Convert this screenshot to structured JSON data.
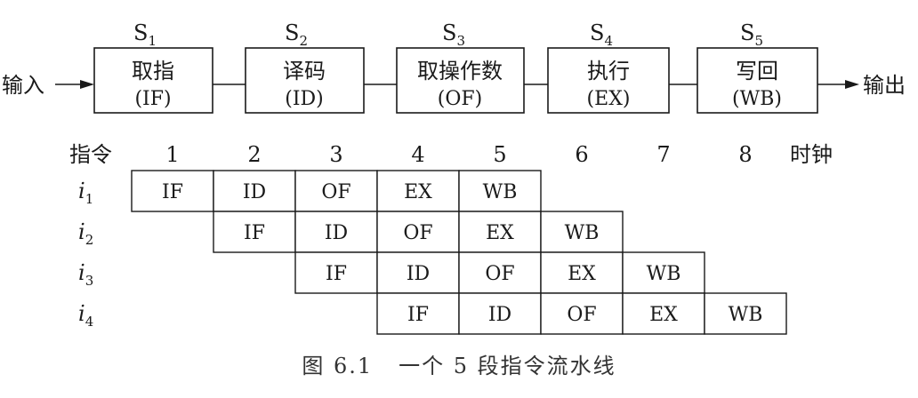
{
  "input_label": "输入",
  "output_label": "输出",
  "stages": [
    {
      "sub_prefix": "S",
      "sub_index": "1",
      "name": "取指",
      "abbr": "(IF)"
    },
    {
      "sub_prefix": "S",
      "sub_index": "2",
      "name": "译码",
      "abbr": "(ID)"
    },
    {
      "sub_prefix": "S",
      "sub_index": "3",
      "name": "取操作数",
      "abbr": "(OF)"
    },
    {
      "sub_prefix": "S",
      "sub_index": "4",
      "name": "执行",
      "abbr": "(EX)"
    },
    {
      "sub_prefix": "S",
      "sub_index": "5",
      "name": "写回",
      "abbr": "(WB)"
    }
  ],
  "table": {
    "instr_header": "指令",
    "clock_header": "时钟",
    "clocks": [
      "1",
      "2",
      "3",
      "4",
      "5",
      "6",
      "7",
      "8"
    ],
    "rows": [
      {
        "prefix": "i",
        "index": "1",
        "start": 0,
        "cells": [
          "IF",
          "ID",
          "OF",
          "EX",
          "WB"
        ]
      },
      {
        "prefix": "i",
        "index": "2",
        "start": 1,
        "cells": [
          "IF",
          "ID",
          "OF",
          "EX",
          "WB"
        ]
      },
      {
        "prefix": "i",
        "index": "3",
        "start": 2,
        "cells": [
          "IF",
          "ID",
          "OF",
          "EX",
          "WB"
        ]
      },
      {
        "prefix": "i",
        "index": "4",
        "start": 3,
        "cells": [
          "IF",
          "ID",
          "OF",
          "EX",
          "WB"
        ]
      }
    ]
  },
  "caption": "图 6.1   一个 5 段指令流水线"
}
